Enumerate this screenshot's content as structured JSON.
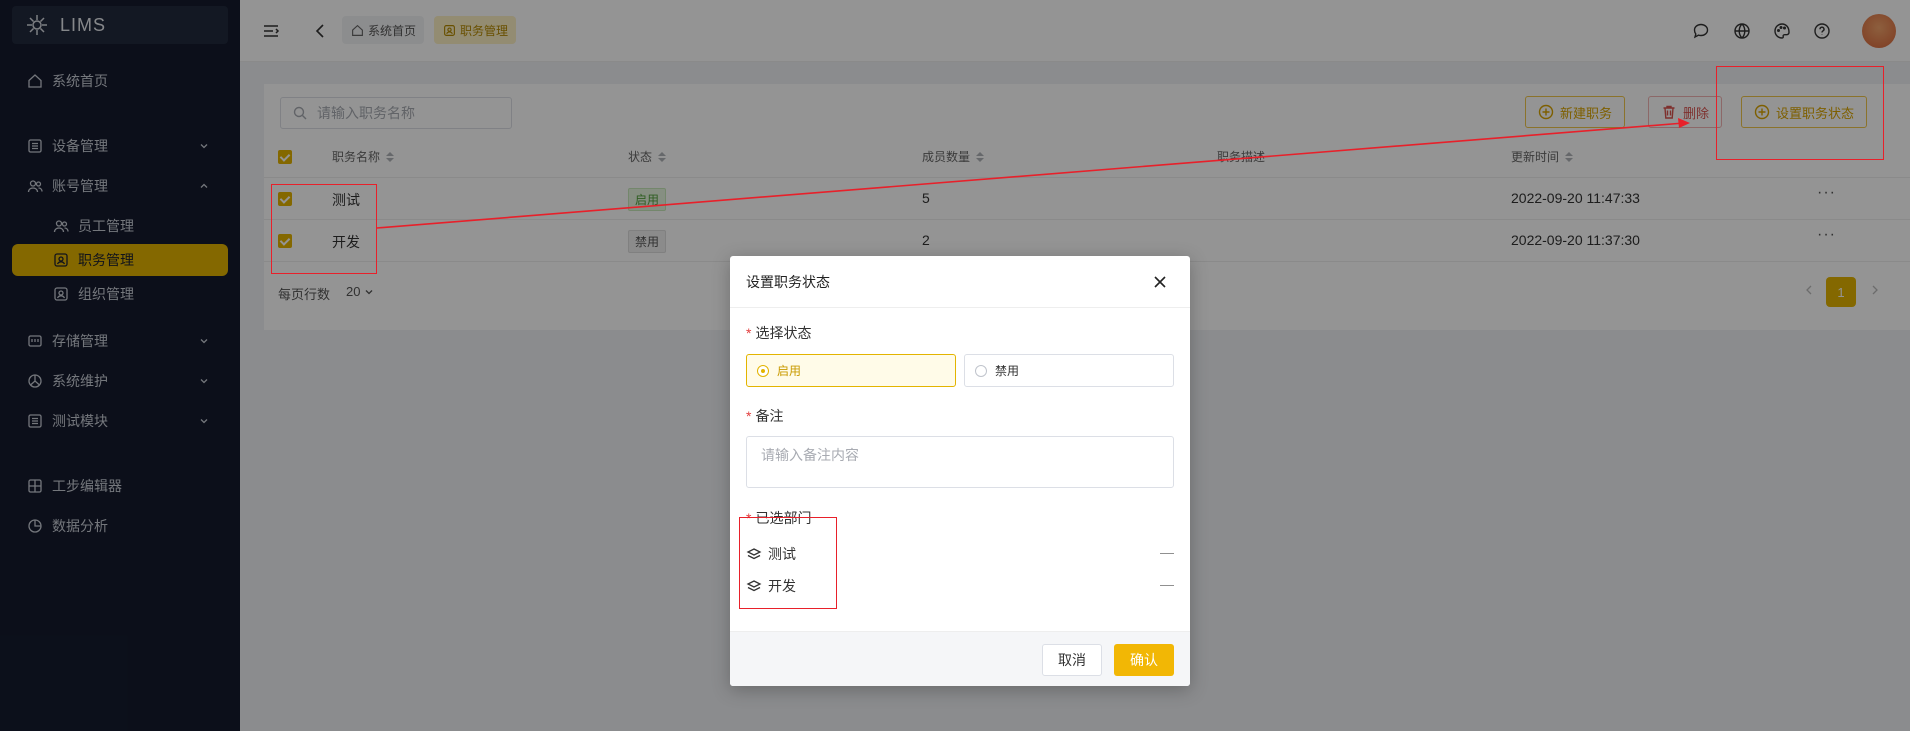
{
  "app": {
    "logo_text": "LIMS"
  },
  "sidebar": {
    "items": [
      {
        "label": "系统首页",
        "icon": "home-icon"
      },
      {
        "label": "设备管理",
        "icon": "device-icon"
      },
      {
        "label": "账号管理",
        "icon": "users-icon"
      },
      {
        "label": "员工管理",
        "icon": "users-icon"
      },
      {
        "label": "职务管理",
        "icon": "id-card-icon"
      },
      {
        "label": "组织管理",
        "icon": "org-icon"
      },
      {
        "label": "存储管理",
        "icon": "storage-icon"
      },
      {
        "label": "系统维护",
        "icon": "maintenance-icon"
      },
      {
        "label": "测试模块",
        "icon": "test-icon"
      },
      {
        "label": "工步编辑器",
        "icon": "grid-icon"
      },
      {
        "label": "数据分析",
        "icon": "pie-icon"
      }
    ],
    "active_item": "职务管理"
  },
  "header": {
    "breadcrumbs": [
      "系统首页",
      "职务管理"
    ]
  },
  "toolbar": {
    "search_placeholder": "请输入职务名称",
    "new_label": "新建职务",
    "delete_label": "删除",
    "set_status_label": "设置职务状态"
  },
  "table": {
    "columns": [
      "职务名称",
      "状态",
      "成员数量",
      "职务描述",
      "更新时间"
    ],
    "rows": [
      {
        "name": "测试",
        "status": "启用",
        "members": "5",
        "description": "",
        "updated": "2022-09-20 11:47:33",
        "more": "···"
      },
      {
        "name": "开发",
        "status": "禁用",
        "members": "2",
        "description": "",
        "updated": "2022-09-20 11:37:30",
        "more": "···"
      }
    ]
  },
  "pager": {
    "rows_per_page_label": "每页行数",
    "rows_per_page": "20",
    "current_page": "1"
  },
  "modal": {
    "title": "设置职务状态",
    "status_label": "选择状态",
    "status_options": [
      "启用",
      "禁用"
    ],
    "selected_status": "启用",
    "remark_label": "备注",
    "remark_placeholder": "请输入备注内容",
    "dept_label": "已选部门",
    "departments": [
      "测试",
      "开发"
    ],
    "dept_remove_glyph": "—",
    "cancel_label": "取消",
    "confirm_label": "确认"
  },
  "colors": {
    "accent": "#e3b400",
    "sidebar_bg": "#151b2e",
    "annotation": "#e8202a"
  }
}
